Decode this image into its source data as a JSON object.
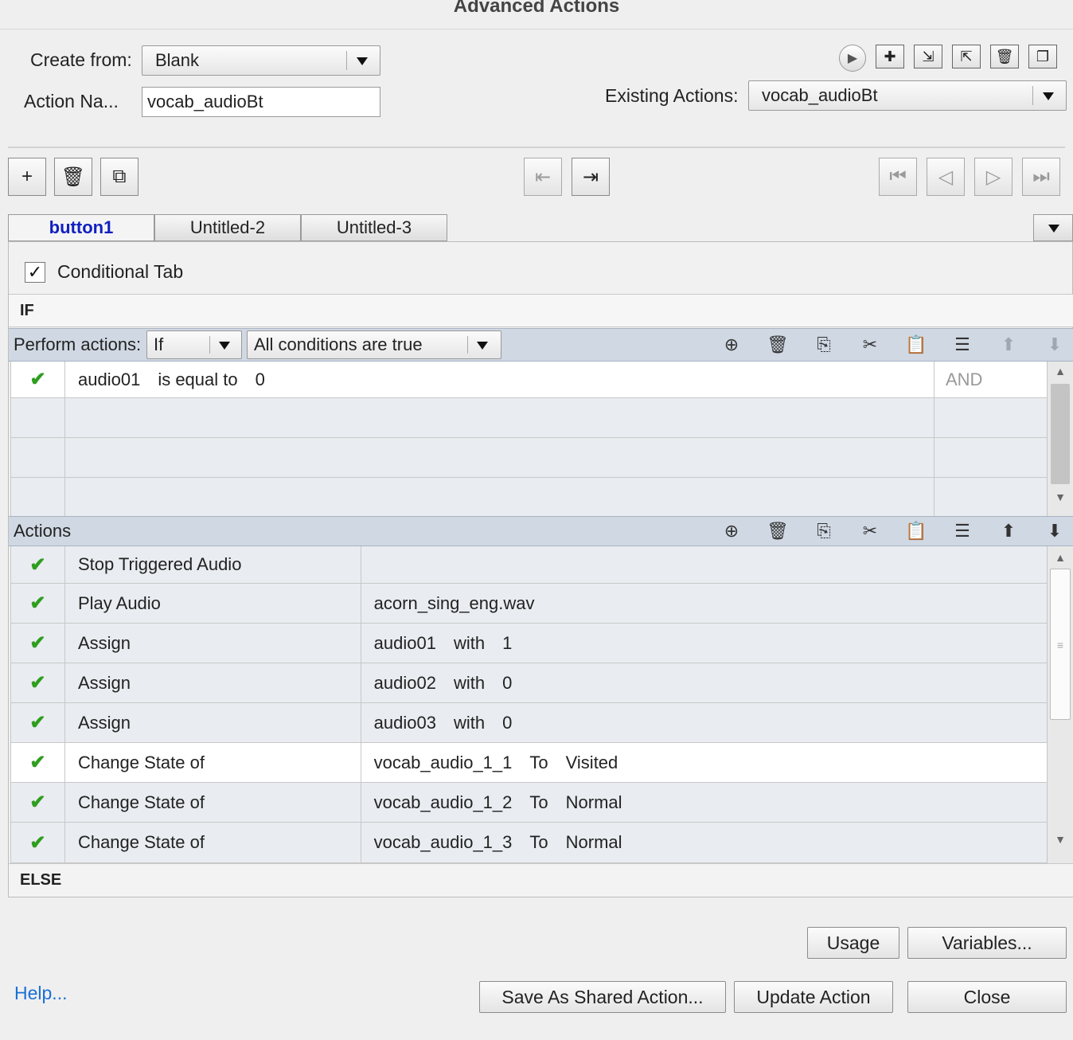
{
  "window": {
    "title": "Advanced Actions"
  },
  "header": {
    "create_from_label": "Create from:",
    "create_from_value": "Blank",
    "action_name_label": "Action Na...",
    "action_name_value": "vocab_audioBt",
    "existing_actions_label": "Existing Actions:",
    "existing_actions_value": "vocab_audioBt"
  },
  "tabs": [
    {
      "label": "button1",
      "active": true
    },
    {
      "label": "Untitled-2",
      "active": false
    },
    {
      "label": "Untitled-3",
      "active": false
    }
  ],
  "conditional": {
    "checkbox_label": "Conditional Tab",
    "checked": true
  },
  "if_section": {
    "heading": "IF",
    "perform_label": "Perform actions:",
    "perform_value": "If",
    "condition_mode": "All conditions are true",
    "conditions": [
      {
        "enabled": true,
        "variable": "audio01",
        "operator": "is equal to",
        "value": "0",
        "join": "AND"
      }
    ]
  },
  "actions_section": {
    "heading": "Actions",
    "rows": [
      {
        "action": "Stop Triggered Audio",
        "parts": []
      },
      {
        "action": "Play Audio",
        "parts": [
          "acorn_sing_eng.wav"
        ]
      },
      {
        "action": "Assign",
        "parts": [
          "audio01",
          "with",
          "1"
        ]
      },
      {
        "action": "Assign",
        "parts": [
          "audio02",
          "with",
          "0"
        ]
      },
      {
        "action": "Assign",
        "parts": [
          "audio03",
          "with",
          "0"
        ]
      },
      {
        "action": "Change State of",
        "parts": [
          "vocab_audio_1_1",
          "To",
          "Visited"
        ]
      },
      {
        "action": "Change State of",
        "parts": [
          "vocab_audio_1_2",
          "To",
          "Normal"
        ]
      },
      {
        "action": "Change State of",
        "parts": [
          "vocab_audio_1_3",
          "To",
          "Normal"
        ]
      }
    ]
  },
  "else_section": {
    "heading": "ELSE"
  },
  "footer": {
    "usage": "Usage",
    "variables": "Variables...",
    "help": "Help...",
    "save_shared": "Save As Shared Action...",
    "update": "Update Action",
    "close": "Close"
  },
  "colors": {
    "accent_link": "#1a6fd6",
    "check_green": "#2e9e1f",
    "active_tab": "#1020c0"
  }
}
